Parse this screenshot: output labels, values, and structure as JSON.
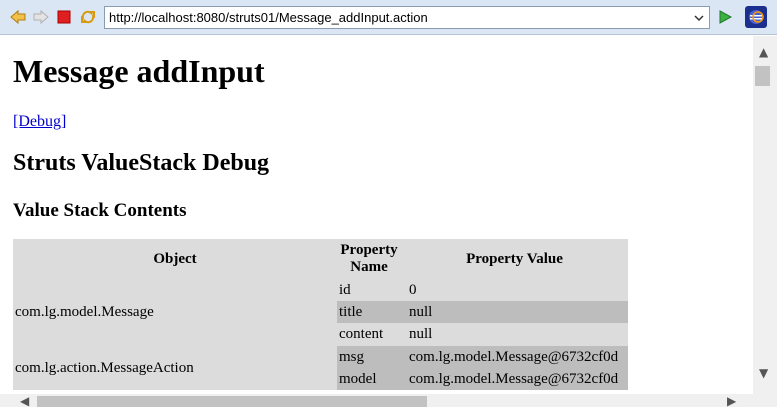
{
  "toolbar": {
    "back_icon": "arrow-left-icon",
    "forward_icon": "arrow-right-icon",
    "stop_icon": "stop-icon",
    "refresh_icon": "refresh-icon",
    "url": "http://localhost:8080/struts01/Message_addInput.action",
    "go_icon": "play-icon",
    "app_icon": "eclipse-icon"
  },
  "page": {
    "title": "Message addInput",
    "debug_link": "[Debug]",
    "section_title": "Struts ValueStack Debug",
    "sub_title": "Value Stack Contents"
  },
  "table": {
    "headers": [
      "Object",
      "Property Name",
      "Property Value"
    ],
    "objects": [
      {
        "name": "com.lg.model.Message",
        "properties": [
          {
            "name": "id",
            "value": "0"
          },
          {
            "name": "title",
            "value": "null"
          },
          {
            "name": "content",
            "value": "null"
          }
        ]
      },
      {
        "name": "com.lg.action.MessageAction",
        "properties": [
          {
            "name": "msg",
            "value": "com.lg.model.Message@6732cf0d"
          },
          {
            "name": "model",
            "value": "com.lg.model.Message@6732cf0d"
          }
        ]
      }
    ]
  },
  "colors": {
    "toolbar_bg": "#dbe6f4",
    "link": "#0000cc",
    "row_light": "#dcdcdc",
    "row_dark": "#bdbdbd"
  }
}
